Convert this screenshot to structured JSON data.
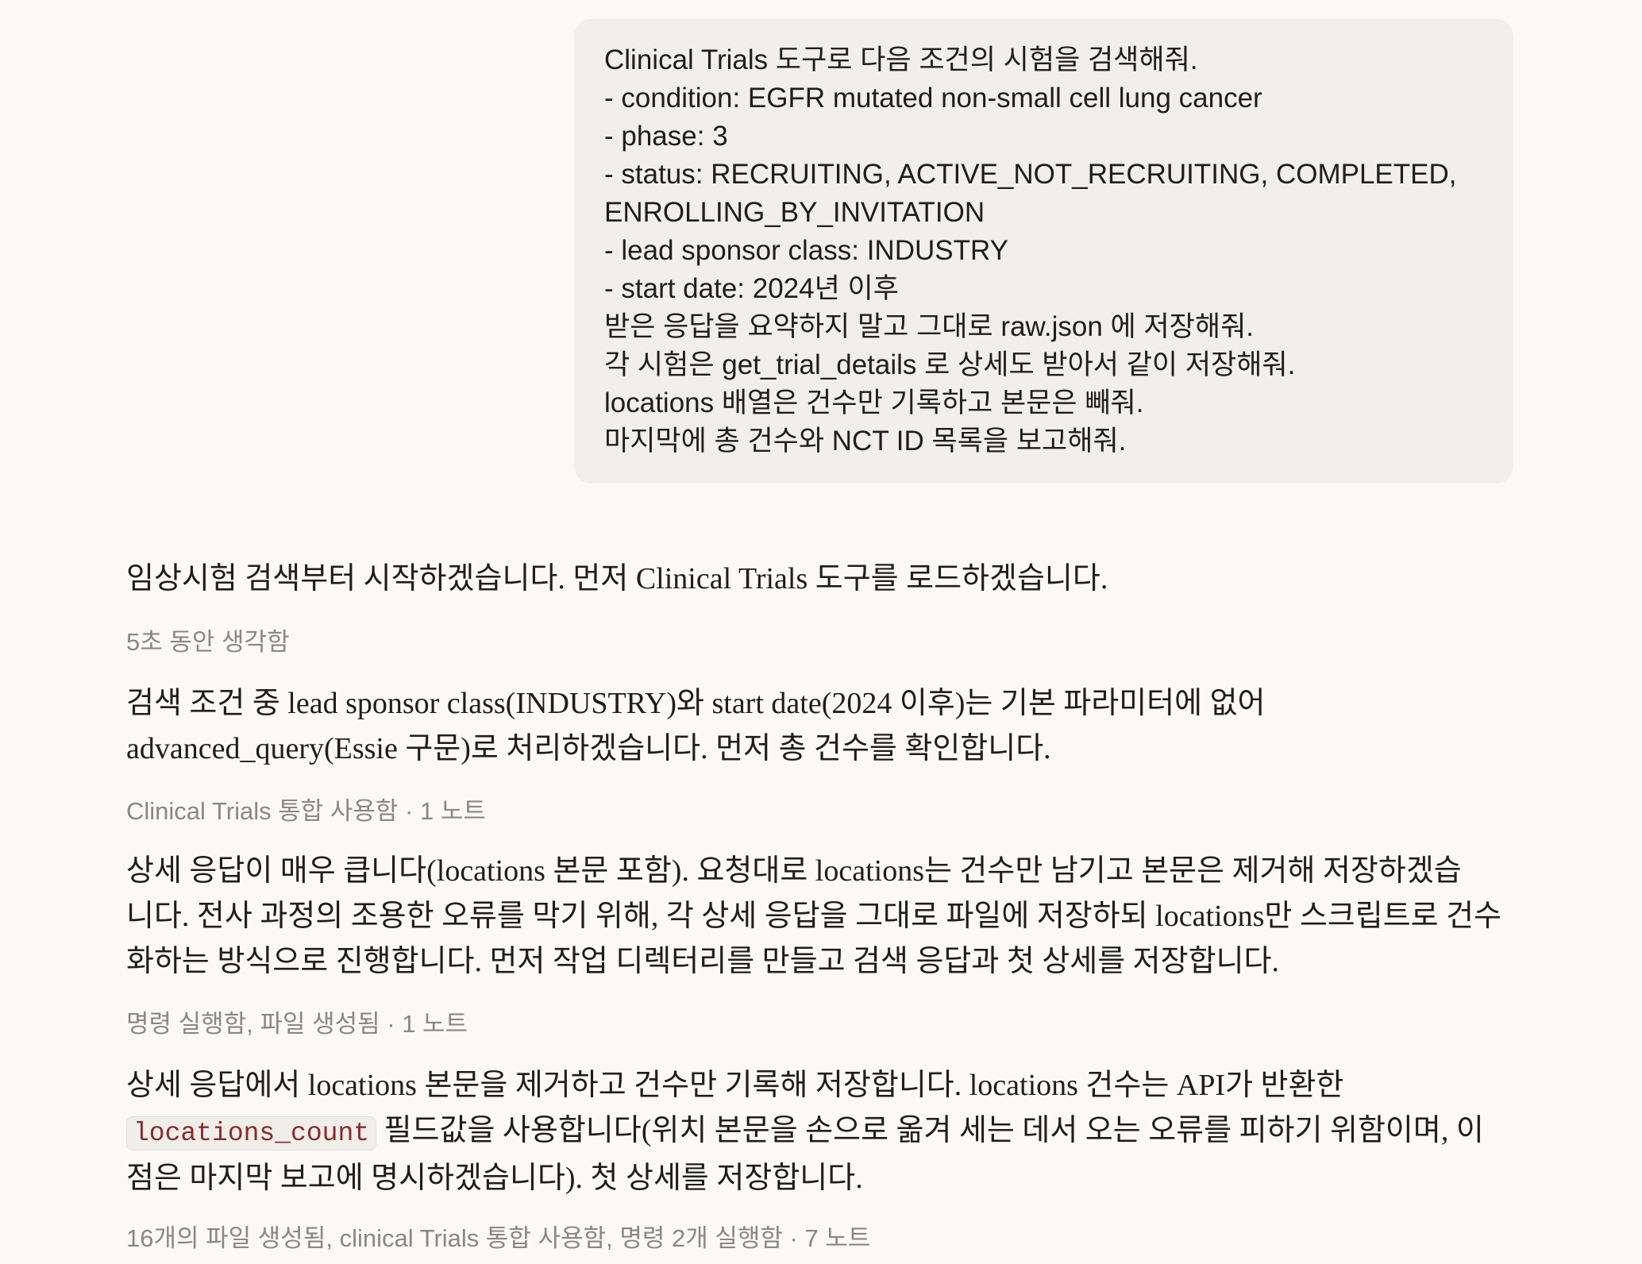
{
  "user_message": {
    "lines": [
      "Clinical Trials 도구로 다음 조건의 시험을 검색해줘.",
      "- condition: EGFR mutated non-small cell lung cancer",
      "- phase: 3",
      "- status: RECRUITING, ACTIVE_NOT_RECRUITING, COMPLETED,",
      "ENROLLING_BY_INVITATION",
      "- lead sponsor class: INDUSTRY",
      "- start date: 2024년 이후",
      "받은 응답을 요약하지 말고 그대로 raw.json 에 저장해줘.",
      "각 시험은 get_trial_details 로 상세도 받아서 같이 저장해줘.",
      "locations 배열은 건수만 기록하고 본문은 빼줘.",
      "마지막에 총 건수와 NCT ID 목록을 보고해줘."
    ]
  },
  "assistant": {
    "p1": "임상시험 검색부터 시작하겠습니다. 먼저 Clinical Trials 도구를 로드하겠습니다.",
    "meta1": "5초 동안 생각함",
    "p2": {
      "line1": "검색 조건 중 lead sponsor class(INDUSTRY)와 start date(2024 이후)는 기본 파라미터에 없어",
      "line2": "advanced_query(Essie 구문)로 처리하겠습니다. 먼저 총 건수를 확인합니다."
    },
    "meta2": "Clinical Trials 통합 사용함 · 1 노트",
    "p3": {
      "line1": "상세 응답이 매우 큽니다(locations 본문 포함). 요청대로 locations는 건수만 남기고 본문은 제거해 저장하겠습",
      "line2": "니다. 전사 과정의 조용한 오류를 막기 위해, 각 상세 응답을 그대로 파일에 저장하되 locations만 스크립트로 건수",
      "line3": "화하는 방식으로 진행합니다. 먼저 작업 디렉터리를 만들고 검색 응답과 첫 상세를 저장합니다."
    },
    "meta3": "명령 실행함, 파일 생성됨 · 1 노트",
    "p4": {
      "line1": "상세 응답에서 locations 본문을 제거하고 건수만 기록해 저장합니다. locations 건수는 API가 반환한",
      "code": "locations_count",
      "line2_rest": " 필드값을 사용합니다(위치 본문을 손으로 옮겨 세는 데서 오는 오류를 피하기 위함이며, 이",
      "line3": "점은 마지막 보고에 명시하겠습니다). 첫 상세를 저장합니다."
    },
    "meta4": "16개의 파일 생성됨, clinical Trials 통합 사용함, 명령 2개 실행함 · 7 노트"
  }
}
